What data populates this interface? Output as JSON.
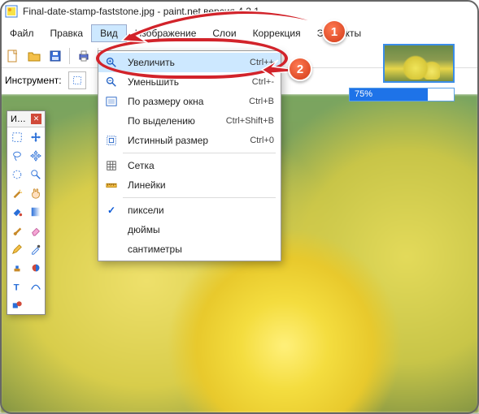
{
  "titlebar": {
    "text": "Final-date-stamp-faststone.jpg - paint.net версия 4.2.1"
  },
  "menubar": {
    "items": [
      {
        "id": "file",
        "label": "Файл"
      },
      {
        "id": "edit",
        "label": "Правка"
      },
      {
        "id": "view",
        "label": "Вид"
      },
      {
        "id": "image",
        "label": "Изображение"
      },
      {
        "id": "layers",
        "label": "Слои"
      },
      {
        "id": "adjust",
        "label": "Коррекция"
      },
      {
        "id": "effects",
        "label": "Эффекты"
      }
    ]
  },
  "toolbar_icons": [
    "new",
    "open",
    "save",
    "print",
    "zoom-in"
  ],
  "instrument": {
    "label": "Инструмент:"
  },
  "dropdown": {
    "items": [
      {
        "id": "zoom-in",
        "label": "Увеличить",
        "shortcut": "Ctrl++",
        "highlight": true,
        "icon": "zoom-in"
      },
      {
        "id": "zoom-out",
        "label": "Уменьшить",
        "shortcut": "Ctrl+-",
        "icon": "zoom-out"
      },
      {
        "id": "fit-window",
        "label": "По размеру окна",
        "shortcut": "Ctrl+B",
        "icon": "fit"
      },
      {
        "id": "fit-selection",
        "label": "По выделению",
        "shortcut": "Ctrl+Shift+B",
        "icon": ""
      },
      {
        "id": "actual-size",
        "label": "Истинный размер",
        "shortcut": "Ctrl+0",
        "icon": "actual"
      },
      {
        "sep": true
      },
      {
        "id": "grid",
        "label": "Сетка",
        "shortcut": "",
        "icon": "grid"
      },
      {
        "id": "rulers",
        "label": "Линейки",
        "shortcut": "",
        "icon": "ruler"
      },
      {
        "sep": true
      },
      {
        "id": "px",
        "label": "пиксели",
        "shortcut": "",
        "checked": true
      },
      {
        "id": "in",
        "label": "дюймы",
        "shortcut": ""
      },
      {
        "id": "cm",
        "label": "сантиметры",
        "shortcut": ""
      }
    ]
  },
  "zoom": {
    "text": "75%"
  },
  "toolwin": {
    "title": "И…"
  },
  "badges": {
    "b1": "1",
    "b2": "2"
  }
}
